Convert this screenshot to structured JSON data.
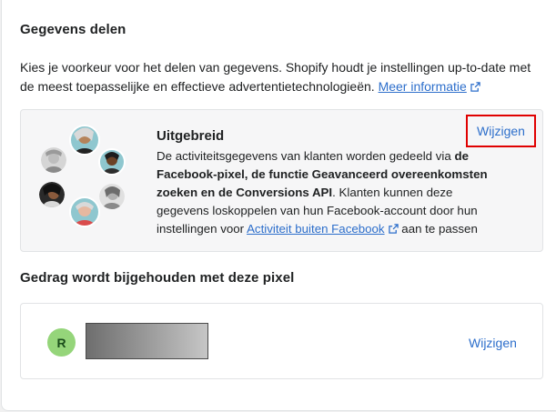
{
  "share": {
    "title": "Gegevens delen",
    "intro": "Kies je voorkeur voor het delen van gegevens. Shopify houdt je instellingen up-to-date met de meest toepasselijke en effectieve advertentietechnologieën.",
    "more_info_link": "Meer informatie"
  },
  "level": {
    "title": "Uitgebreid",
    "edit_label": "Wijzigen",
    "desc_part1": "De activiteitsgegevens van klanten worden gedeeld via ",
    "desc_bold": "de Facebook-pixel, de functie Geavanceerd overeenkomsten zoeken en de Conversions API",
    "desc_part2": ". Klanten kunnen deze gegevens loskoppelen van hun Facebook-account door hun instellingen voor ",
    "desc_link": "Activiteit buiten Facebook",
    "desc_part3": " aan te passen"
  },
  "pixel": {
    "title": "Gedrag wordt bijgehouden met deze pixel",
    "avatar_letter": "R",
    "edit_label": "Wijzigen"
  },
  "colors": {
    "link": "#2c6ecb",
    "highlight_border": "#e00000",
    "avatar_bg": "#95d57a"
  }
}
